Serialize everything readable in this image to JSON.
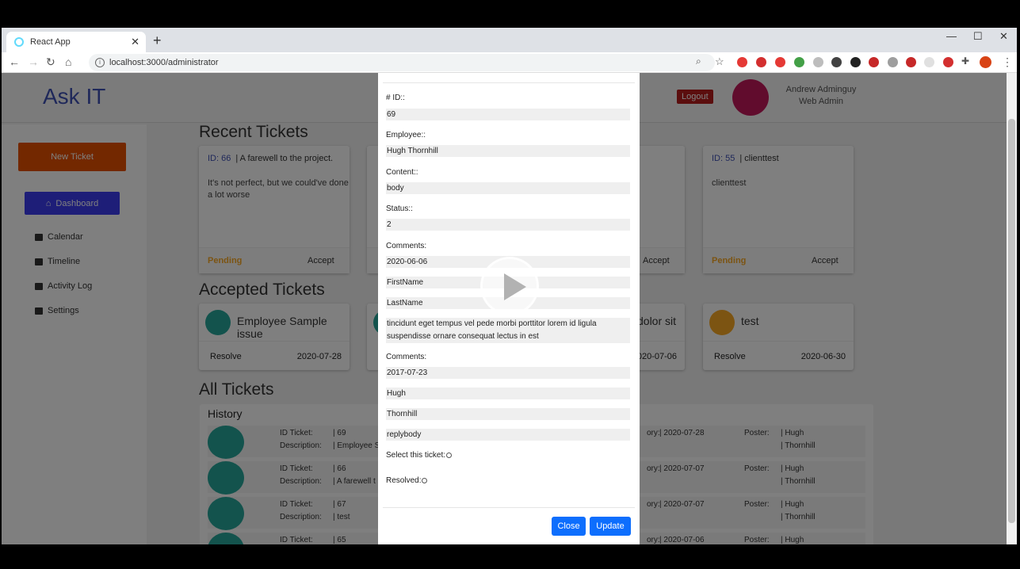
{
  "browser": {
    "tab_title": "React App",
    "url": "localhost:3000/administrator"
  },
  "app": {
    "logo": "Ask IT",
    "logout_label": "Logout",
    "user_name": "Andrew Adminguy",
    "user_role": "Web Admin"
  },
  "sidebar": {
    "new_ticket": "New Ticket",
    "dashboard": "Dashboard",
    "items": [
      "Calendar",
      "Timeline",
      "Activity Log",
      "Settings"
    ]
  },
  "sections": {
    "recent": "Recent Tickets",
    "accepted": "Accepted Tickets",
    "all": "All Tickets",
    "history": "History"
  },
  "recent_tickets": [
    {
      "id": "ID: 66",
      "title": "| A farewell to the project.",
      "body": "It's not perfect, but we could've done a lot worse",
      "status": "Pending",
      "action": "Accept"
    },
    {
      "id": "",
      "title": "",
      "body": "",
      "status": "",
      "action": "Accept"
    },
    {
      "id": "ID: 55",
      "title": "| clienttest",
      "body": "clienttest",
      "status": "Pending",
      "action": "Accept"
    }
  ],
  "accepted_tickets": [
    {
      "title": "Employee Sample issue",
      "action": "Resolve",
      "date": "2020-07-28"
    },
    {
      "title": "dolor sit",
      "action": "",
      "date": "2020-07-06"
    },
    {
      "title": "test",
      "action": "Resolve",
      "date": "2020-06-30"
    }
  ],
  "history_rows": [
    {
      "id_label": "ID Ticket:",
      "id": "| 69",
      "desc_label": "Description:",
      "desc": "| Employee S",
      "date_label": "ory:",
      "date": "| 2020-07-28",
      "poster_label": "Poster:",
      "poster1": "| Hugh",
      "poster2": "| Thornhill"
    },
    {
      "id_label": "ID Ticket:",
      "id": "| 66",
      "desc_label": "Description:",
      "desc": "| A farewell t",
      "date_label": "ory:",
      "date": "| 2020-07-07",
      "poster_label": "Poster:",
      "poster1": "| Hugh",
      "poster2": "| Thornhill"
    },
    {
      "id_label": "ID Ticket:",
      "id": "| 67",
      "desc_label": "Description:",
      "desc": "| test",
      "date_label": "ory:",
      "date": "| 2020-07-07",
      "poster_label": "Poster:",
      "poster1": "| Hugh",
      "poster2": "| Thornhill"
    },
    {
      "id_label": "ID Ticket:",
      "id": "| 65",
      "desc_label": "",
      "desc": "",
      "date_label": "ory:",
      "date": "| 2020-07-06",
      "poster_label": "Poster:",
      "poster1": "| Hugh",
      "poster2": ""
    }
  ],
  "modal": {
    "id_label": "# ID::",
    "id": "69",
    "employee_label": "Employee::",
    "employee": "Hugh Thornhill",
    "content_label": "Content::",
    "content": "body",
    "status_label": "Status::",
    "status": "2",
    "comments1_label": "Comments:",
    "comment1_date": "2020-06-06",
    "comment1_first": "FirstName",
    "comment1_last": "LastName",
    "comment1_body": "tincidunt eget tempus vel pede morbi porttitor lorem id ligula suspendisse ornare consequat lectus in est",
    "comments2_label": "Comments:",
    "comment2_date": "2017-07-23",
    "comment2_first": "Hugh",
    "comment2_last": "Thornhill",
    "comment2_body": "replybody",
    "select_label": "Select this ticket:",
    "resolved_label": "Resolved:",
    "close_label": "Close",
    "update_label": "Update"
  },
  "colors": {
    "primary": "#0d6efd",
    "logo": "#3f51b5",
    "new_ticket": "#e65100",
    "dashboard": "#3d3df0",
    "pending": "#f9a825",
    "logout": "#b71c1c"
  }
}
